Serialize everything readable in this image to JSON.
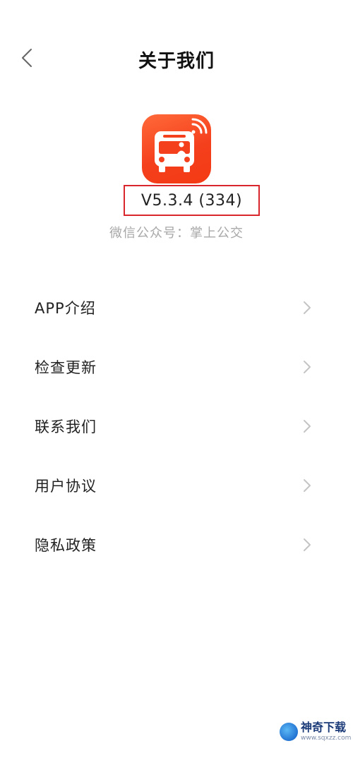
{
  "header": {
    "title": "关于我们",
    "back_icon": "chevron-left-icon"
  },
  "app": {
    "icon": "bus-wifi-icon",
    "icon_color": "#f5401d",
    "version": "V5.3.4 (334)",
    "wechat": "微信公众号：掌上公交"
  },
  "menu": {
    "items": [
      {
        "label": "APP介绍"
      },
      {
        "label": "检查更新"
      },
      {
        "label": "联系我们"
      },
      {
        "label": "用户协议"
      },
      {
        "label": "隐私政策"
      }
    ]
  },
  "watermark": {
    "title": "神奇下载",
    "url": "www.sqxzz.com"
  },
  "colors": {
    "highlight_border": "#d9262c",
    "secondary_text": "#a8a8a8",
    "chevron": "#c4c4c4"
  }
}
